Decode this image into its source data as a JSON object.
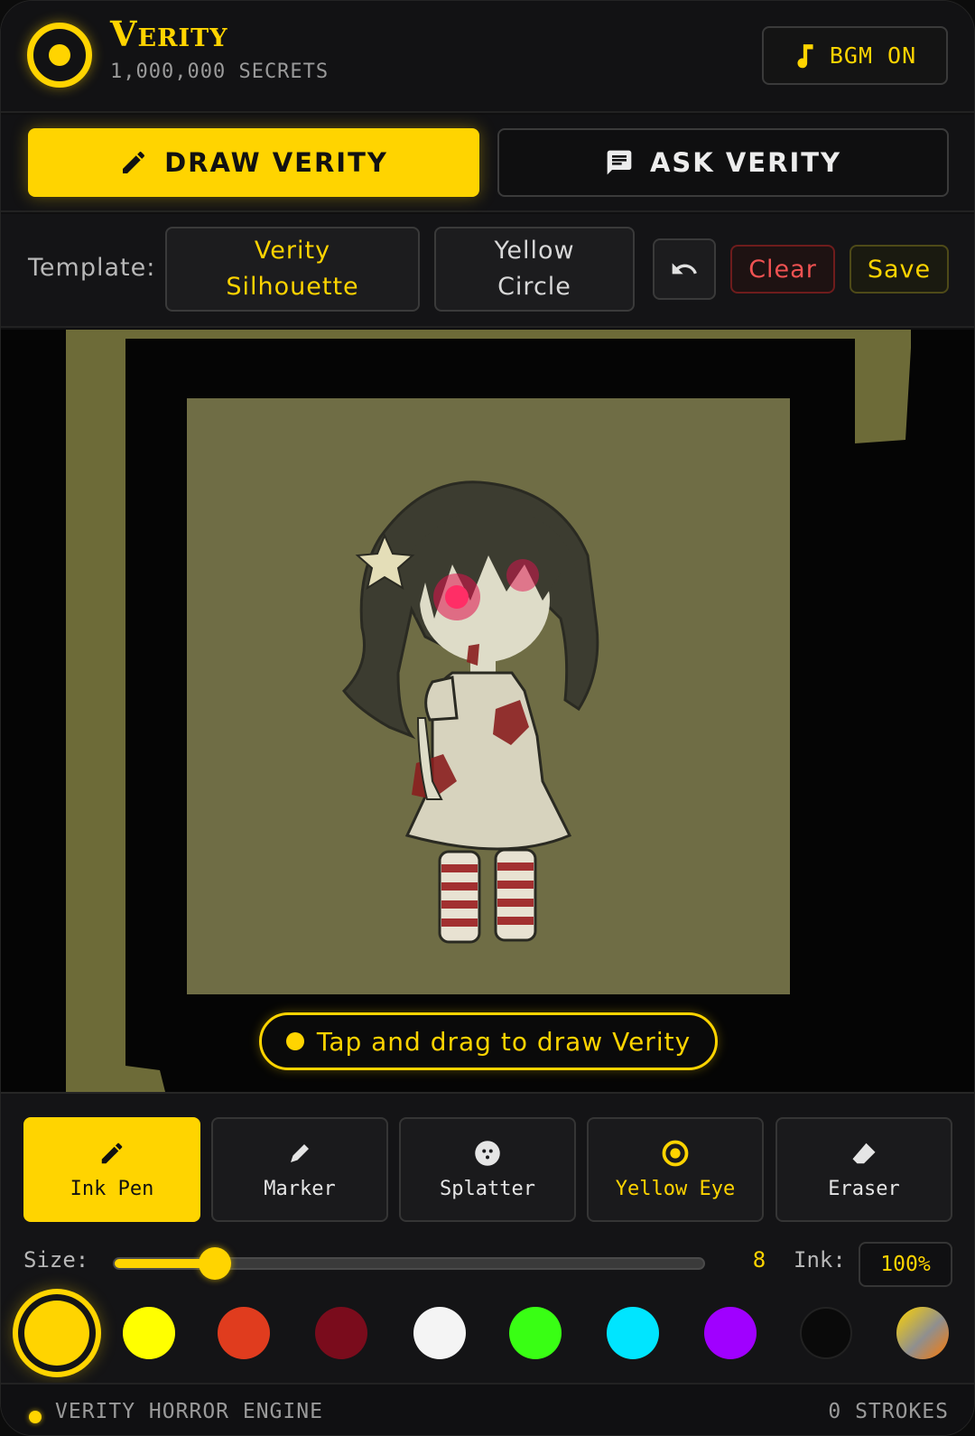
{
  "header": {
    "title": "Verity",
    "subtitle": "1,000,000 SECRETS",
    "bgm_label": "BGM ON",
    "logo_icon": "yellow-eye-icon",
    "bgm_icon": "music-note-icon"
  },
  "modes": {
    "draw_label": "DRAW VERITY",
    "ask_label": "ASK VERITY",
    "active": "draw"
  },
  "toolbar": {
    "template_label": "Template:",
    "templates": [
      {
        "label": "Verity Silhouette",
        "active": true
      },
      {
        "label": "Yellow Circle",
        "active": false
      }
    ],
    "undo_icon": "undo-icon",
    "clear_label": "Clear",
    "save_label": "Save"
  },
  "canvas": {
    "hint": "Tap and drag to draw Verity"
  },
  "tools": [
    {
      "label": "Ink Pen",
      "icon": "pen-icon",
      "active": true
    },
    {
      "label": "Marker",
      "icon": "marker-icon",
      "active": false
    },
    {
      "label": "Splatter",
      "icon": "splatter-icon",
      "active": false
    },
    {
      "label": "Yellow Eye",
      "icon": "eye-icon",
      "active": false
    },
    {
      "label": "Eraser",
      "icon": "eraser-icon",
      "active": false
    }
  ],
  "brush": {
    "size_label": "Size:",
    "size_value": "8",
    "size_fraction": 0.17,
    "ink_label": "Ink:",
    "ink_value": "100%"
  },
  "palette": [
    {
      "color": "#ffd400",
      "selected": true
    },
    {
      "color": "#ffff00",
      "selected": false
    },
    {
      "color": "#e03c1e",
      "selected": false
    },
    {
      "color": "#7a0c1c",
      "selected": false
    },
    {
      "color": "#f4f4f4",
      "selected": false
    },
    {
      "color": "#39ff14",
      "selected": false
    },
    {
      "color": "#00e5ff",
      "selected": false
    },
    {
      "color": "#a000ff",
      "selected": false
    },
    {
      "color": "#0a0a0a",
      "selected": false
    },
    {
      "color": "gradient",
      "selected": false
    }
  ],
  "footer": {
    "left": "VERITY HORROR ENGINE",
    "right": "0 STROKES"
  }
}
